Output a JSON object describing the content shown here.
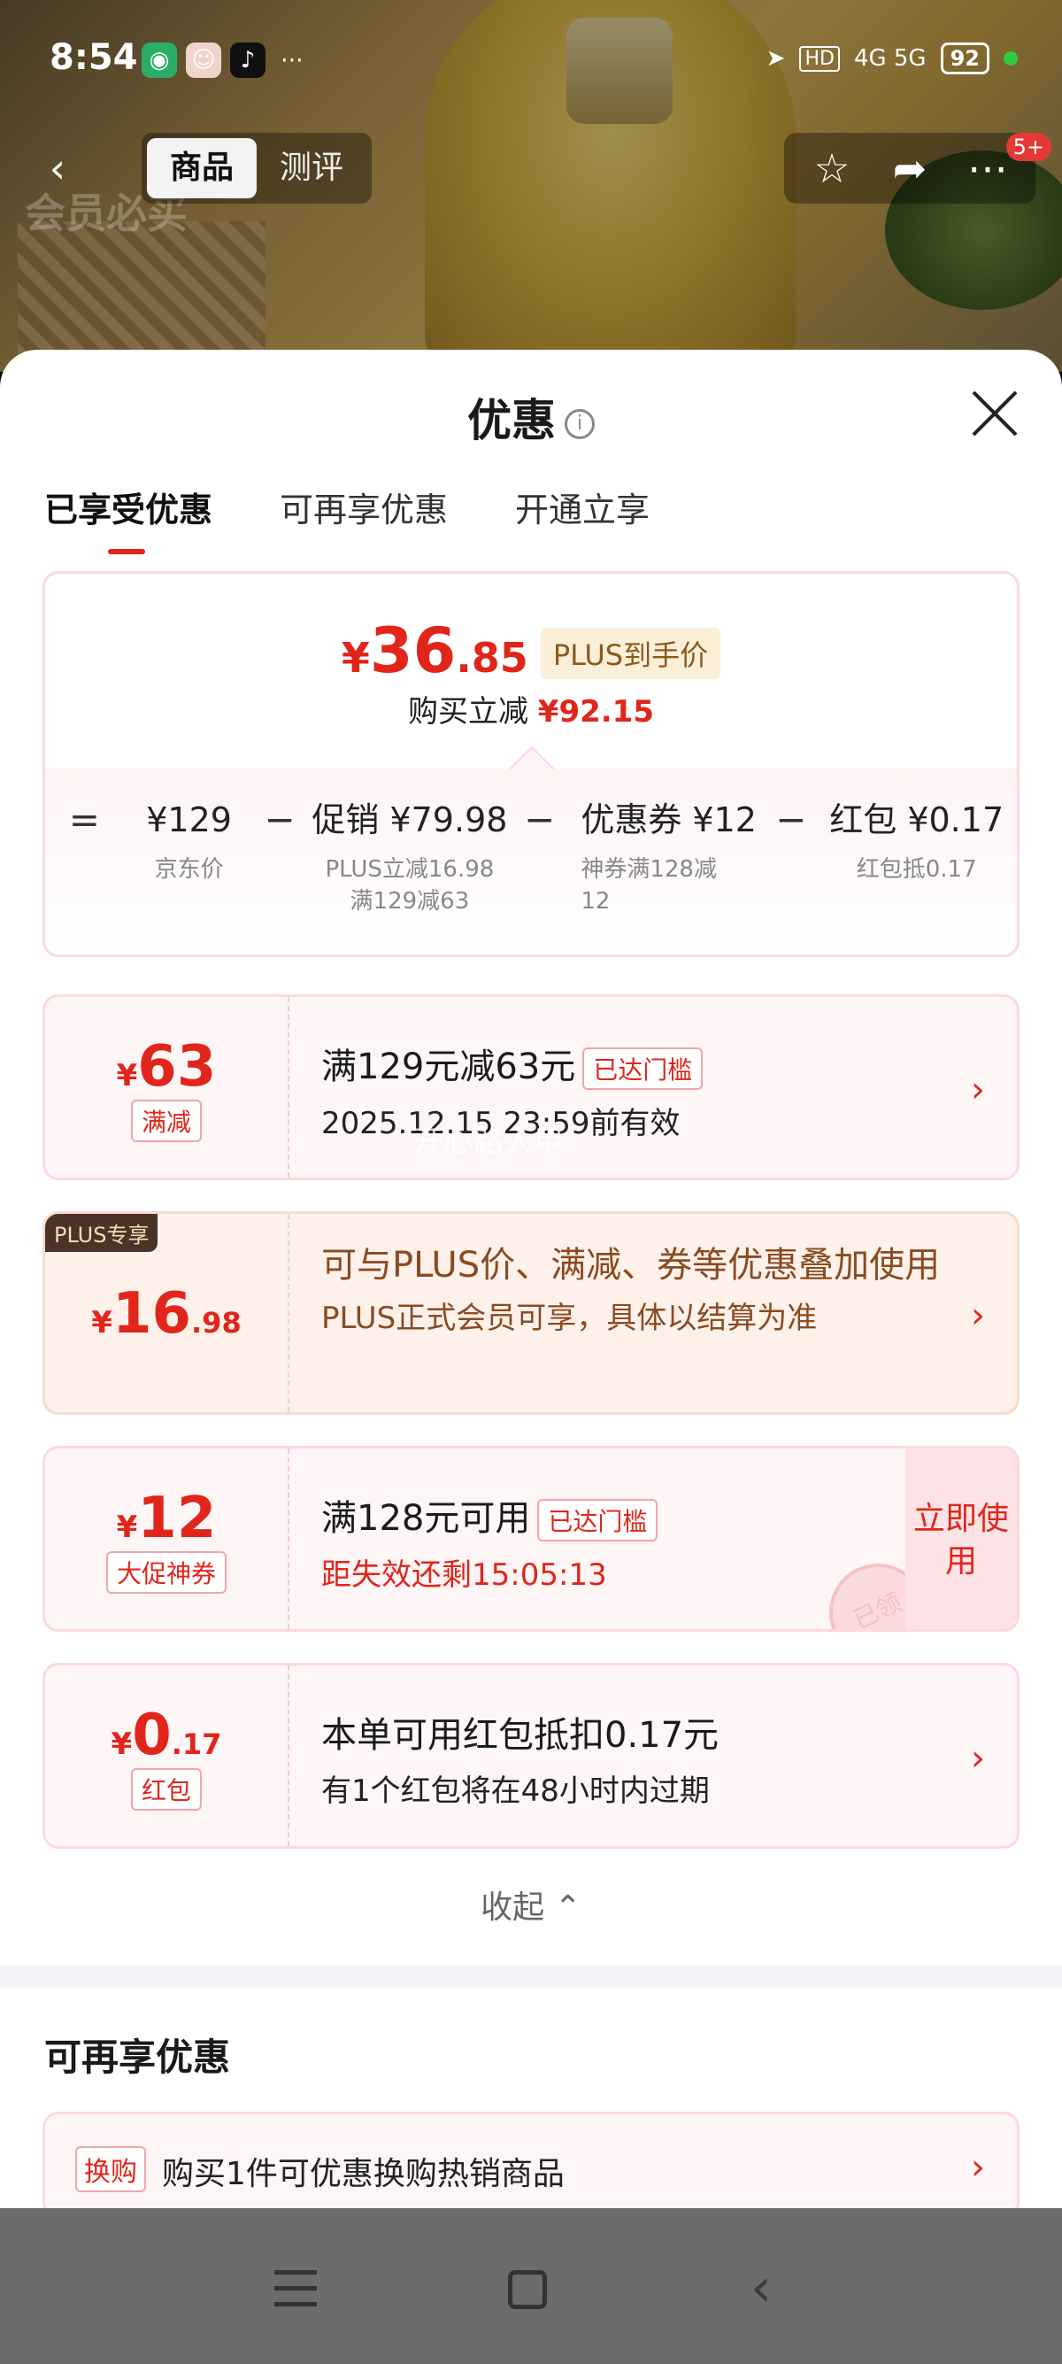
{
  "status_bar": {
    "time": "8:54",
    "battery": "92",
    "network": "4G 5G",
    "hd_label": "HD"
  },
  "nav": {
    "back_icon": "chevron-left-icon",
    "tabs": [
      "商品",
      "测评"
    ],
    "active_tab": "商品",
    "watermark": "会员必买",
    "badge": "5+"
  },
  "sheet": {
    "title": "优惠",
    "tabs": [
      "已享受优惠",
      "可再享优惠",
      "开通立享"
    ]
  },
  "summary": {
    "price_yen": "¥",
    "price_int": "36",
    "price_dec": ".85",
    "price_tag": "PLUS到手价",
    "reduce_label": "购买立减",
    "reduce_amount": "¥92.15",
    "formula": [
      {
        "op": "=",
        "value": "¥129",
        "sub1": "京东价",
        "sub2": ""
      },
      {
        "op": "−",
        "value": "促销 ¥79.98",
        "sub1": "PLUS立减16.98",
        "sub2": "满129减63"
      },
      {
        "op": "−",
        "value": "优惠券 ¥12",
        "sub1": "神券满128减",
        "sub2": "12"
      },
      {
        "op": "−",
        "value": "红包 ¥0.17",
        "sub1": "红包抵0.17",
        "sub2": ""
      }
    ]
  },
  "coupons": [
    {
      "yen": "¥",
      "int": "63",
      "dec": "",
      "tag": "满减",
      "title": "满129元减63元",
      "reach": "已达门槛",
      "sub": "2025.12.15 23:59前有效",
      "overlay": "开心路人甲"
    },
    {
      "plus_only": "PLUS专享",
      "yen": "¥",
      "int": "16",
      "dec": ".98",
      "title": "可与PLUS价、满减、券等优惠叠加使用",
      "sub": "PLUS正式会员可享，具体以结算为准"
    },
    {
      "yen": "¥",
      "int": "12",
      "dec": "",
      "tag": "大促神券",
      "title": "满128元可用",
      "reach": "已达门槛",
      "sub": "距失效还剩15:05:13",
      "use_now": "立即使用",
      "stamp": "已领"
    },
    {
      "yen": "¥",
      "int": "0",
      "dec": ".17",
      "tag": "红包",
      "title": "本单可用红包抵扣0.17元",
      "sub": "有1个红包将在48小时内过期"
    }
  ],
  "collapse_label": "收起",
  "section2": {
    "title": "可再享优惠",
    "swap_tag": "换购",
    "swap_text": "购买1件可优惠换购热销商品"
  }
}
